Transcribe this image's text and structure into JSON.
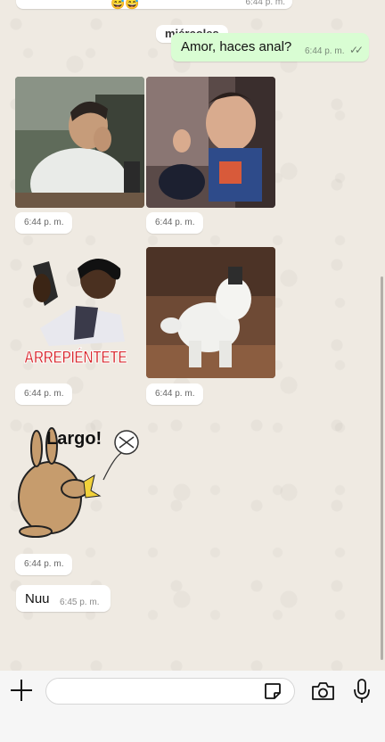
{
  "top_partial": {
    "emoji": "😅😅",
    "time": "6:44 p. m."
  },
  "day_label": "miércoles",
  "outgoing_message": {
    "text": "Amor, haces anal?",
    "time": "6:44 p. m.",
    "status_icon": "double-check-icon"
  },
  "media_messages": [
    {
      "name": "gif-man-laughing",
      "time": "6:44 p. m."
    },
    {
      "name": "gif-toddler-excited",
      "time": "6:44 p. m."
    },
    {
      "name": "sticker-arrepientete",
      "caption": "ARREPIÉNTETE",
      "time": "6:44 p. m."
    },
    {
      "name": "gif-white-dog",
      "time": "6:44 p. m."
    }
  ],
  "sticker_largo": {
    "caption": "Largo!",
    "time": "6:44 p. m."
  },
  "incoming_message": {
    "text": "Nuu",
    "time": "6:45 p. m."
  },
  "composer": {
    "placeholder": "",
    "plus_icon": "plus-icon",
    "sticker_icon": "sticker-icon",
    "camera_icon": "camera-icon",
    "mic_icon": "microphone-icon"
  },
  "colors": {
    "chat_background": "#efeae2",
    "outgoing_bubble": "#d9fdd3",
    "incoming_bubble": "#ffffff",
    "sticker_red": "#d8262c"
  }
}
